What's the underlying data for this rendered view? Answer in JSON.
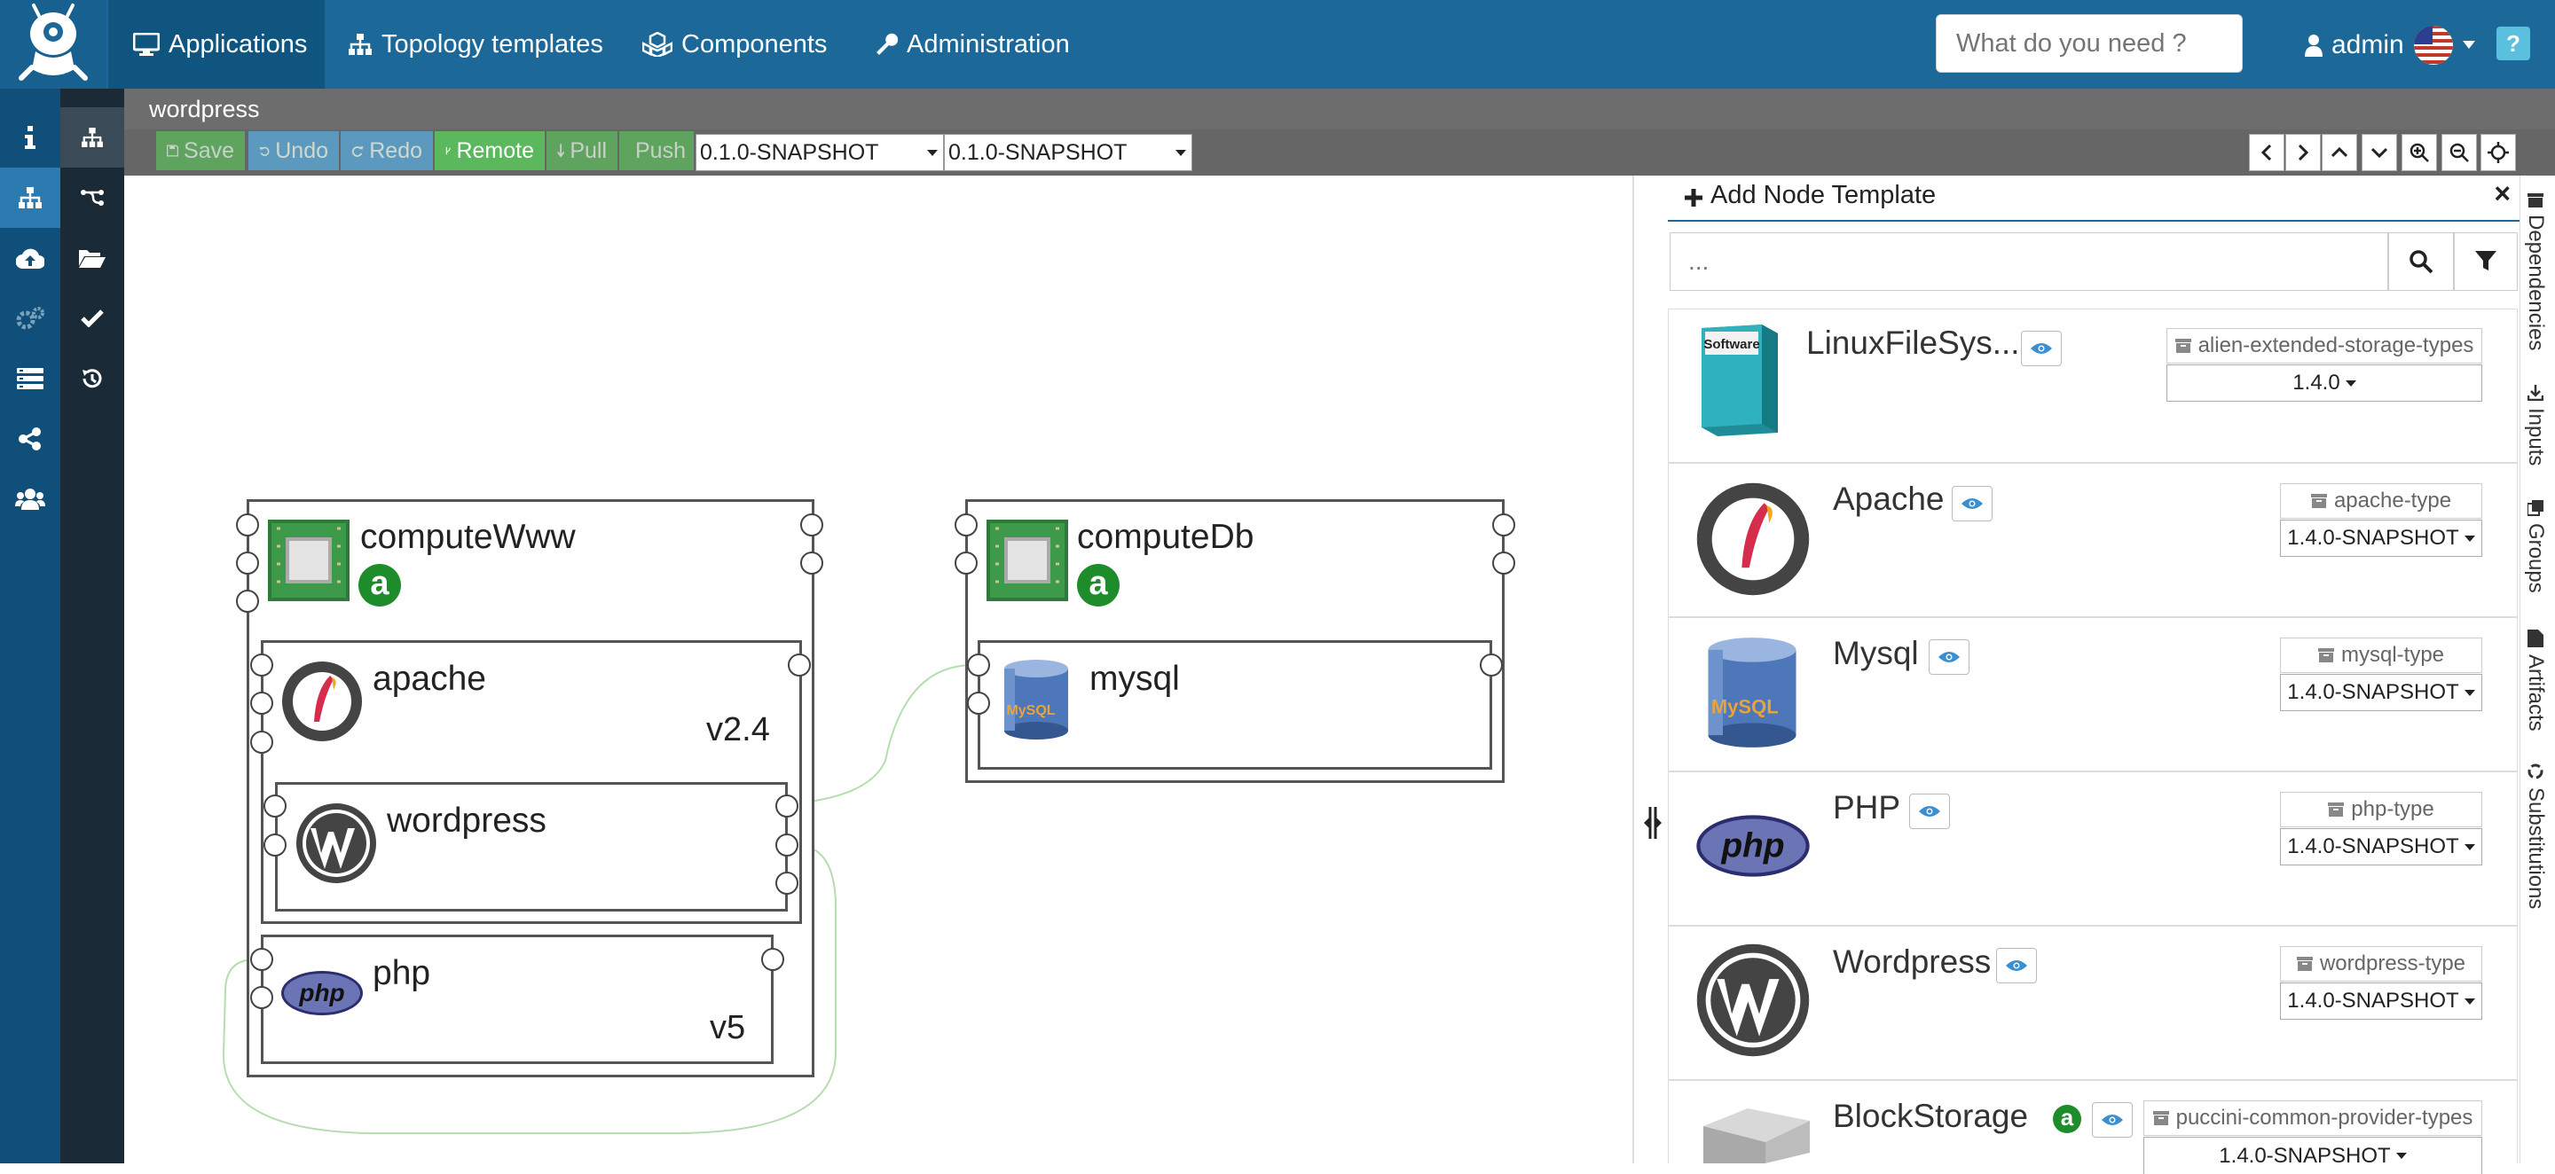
{
  "nav": {
    "items": [
      {
        "label": "Applications",
        "icon": "monitor-icon"
      },
      {
        "label": "Topology templates",
        "icon": "sitemap-icon"
      },
      {
        "label": "Components",
        "icon": "cubes-icon"
      },
      {
        "label": "Administration",
        "icon": "wrench-icon"
      }
    ],
    "search_placeholder": "What do you need ?",
    "user": "admin",
    "help": "?"
  },
  "app": {
    "title": "wordpress"
  },
  "toolbar": {
    "save": "Save",
    "undo": "Undo",
    "redo": "Redo",
    "remote": "Remote",
    "pull": "Pull",
    "push": "Push",
    "version1": "0.1.0-SNAPSHOT",
    "version2": "0.1.0-SNAPSHOT"
  },
  "topology": {
    "computeWww": {
      "name": "computeWww",
      "badge": "a"
    },
    "apache": {
      "name": "apache",
      "version": "v2.4"
    },
    "wordpress": {
      "name": "wordpress"
    },
    "php": {
      "name": "php",
      "version": "v5"
    },
    "computeDb": {
      "name": "computeDb",
      "badge": "a"
    },
    "mysql": {
      "name": "mysql"
    }
  },
  "panel": {
    "title": "Add Node Template",
    "search_placeholder": "...",
    "close": "×",
    "cards": [
      {
        "name": "LinuxFileSys...",
        "type": "alien-extended-storage-types",
        "version": "1.4.0",
        "icon": "software-box-icon"
      },
      {
        "name": "Apache",
        "type": "apache-type",
        "version": "1.4.0-SNAPSHOT",
        "icon": "apache-feather-icon"
      },
      {
        "name": "Mysql",
        "type": "mysql-type",
        "version": "1.4.0-SNAPSHOT",
        "icon": "mysql-cylinder-icon"
      },
      {
        "name": "PHP",
        "type": "php-type",
        "version": "1.4.0-SNAPSHOT",
        "icon": "php-logo-icon"
      },
      {
        "name": "Wordpress",
        "type": "wordpress-type",
        "version": "1.4.0-SNAPSHOT",
        "icon": "wordpress-logo-icon"
      },
      {
        "name": "BlockStorage",
        "type": "puccini-common-provider-types",
        "version": "1.4.0-SNAPSHOT",
        "icon": "block-storage-icon",
        "badge": "a"
      }
    ]
  },
  "right_tabs": [
    "Dependencies",
    "Inputs",
    "Groups",
    "Artifacts",
    "Substitutions"
  ],
  "colors": {
    "topbar": "#1b6899",
    "sidebar": "#0f4f7a",
    "green": "#5cb85c",
    "badge": "#1e8c2a"
  }
}
